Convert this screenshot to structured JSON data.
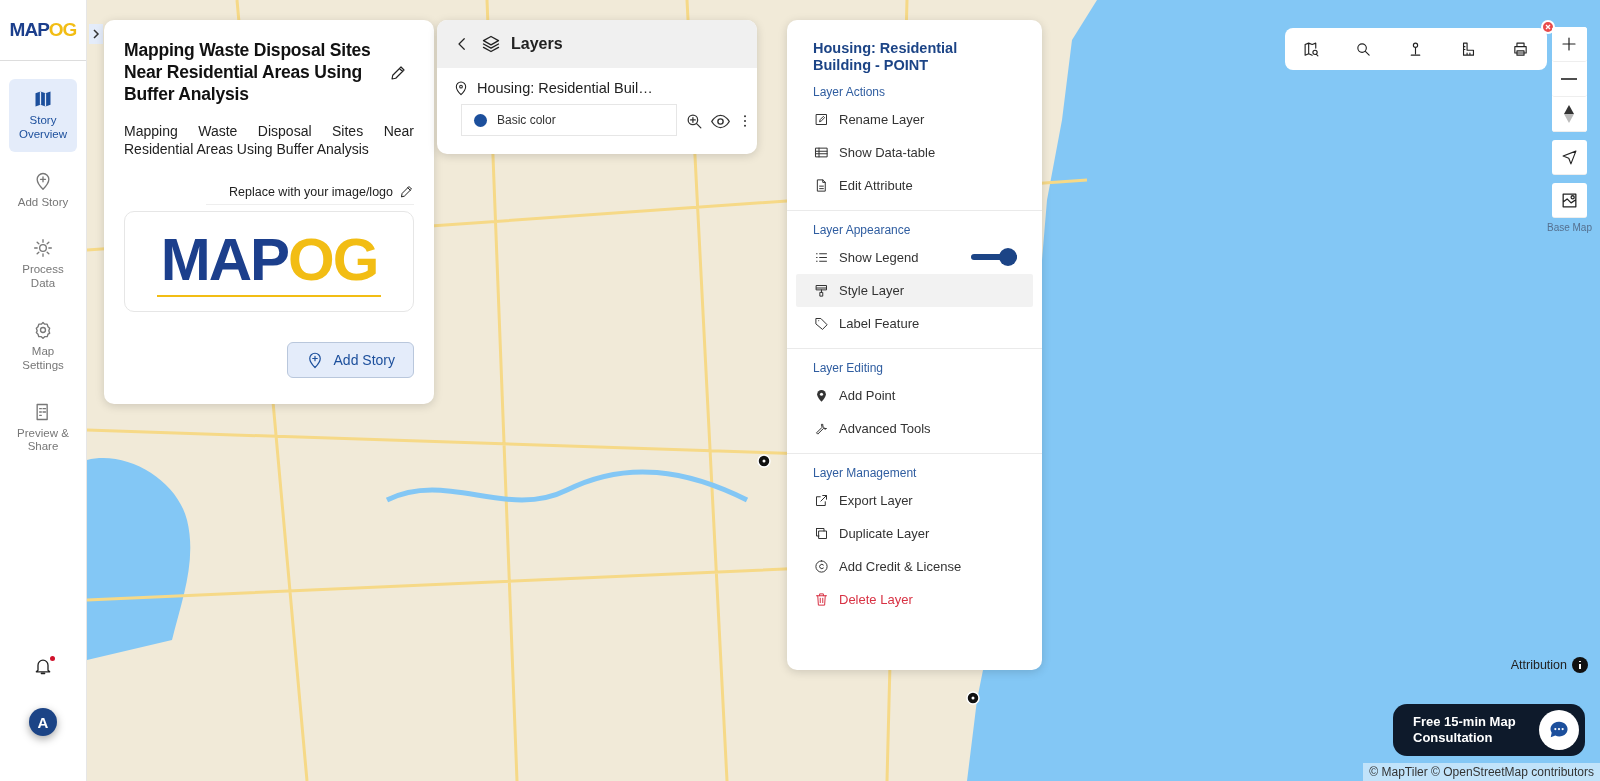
{
  "sidebar": {
    "logo": {
      "primary": "MAP",
      "accent": "OG"
    },
    "items": [
      {
        "label": "Story Overview",
        "selected": true
      },
      {
        "label": "Add Story",
        "selected": false
      },
      {
        "label": "Process Data",
        "selected": false
      },
      {
        "label": "Map Settings",
        "selected": false
      },
      {
        "label": "Preview & Share",
        "selected": false
      }
    ],
    "notifications": {
      "unread": true
    },
    "avatar": {
      "initial": "A"
    }
  },
  "story_card": {
    "title": "Mapping Waste Disposal Sites Near Residential Areas Using Buffer Analysis",
    "description": "Mapping Waste Disposal Sites Near Residential Areas Using Buffer Analysis",
    "image_hint": "Replace with your image/logo",
    "logo": {
      "primary": "MAP",
      "accent": "OG"
    },
    "button": "Add Story"
  },
  "layers_panel": {
    "title": "Layers",
    "layers": [
      {
        "name": "Housing: Residential Buil…",
        "legend": {
          "label": "Basic color",
          "color": "#1c4f9c"
        }
      }
    ]
  },
  "layer_menu": {
    "title": "Housing: Residential Building - POINT",
    "sections": [
      {
        "heading": "Layer Actions",
        "items": [
          {
            "label": "Rename Layer",
            "kind": "action",
            "selected": false
          },
          {
            "label": "Show Data-table",
            "kind": "action",
            "selected": false
          },
          {
            "label": "Edit Attribute",
            "kind": "action",
            "selected": false
          }
        ]
      },
      {
        "heading": "Layer Appearance",
        "items": [
          {
            "label": "Show Legend",
            "kind": "toggle",
            "on": true,
            "selected": false
          },
          {
            "label": "Style Layer",
            "kind": "action",
            "selected": true
          },
          {
            "label": "Label Feature",
            "kind": "action",
            "selected": false
          }
        ]
      },
      {
        "heading": "Layer Editing",
        "items": [
          {
            "label": "Add Point",
            "kind": "action",
            "selected": false
          },
          {
            "label": "Advanced Tools",
            "kind": "action",
            "selected": false
          }
        ]
      },
      {
        "heading": "Layer Management",
        "items": [
          {
            "label": "Export Layer",
            "kind": "action",
            "selected": false
          },
          {
            "label": "Duplicate Layer",
            "kind": "action",
            "selected": false
          },
          {
            "label": "Add Credit & License",
            "kind": "action",
            "selected": false
          },
          {
            "label": "Delete Layer",
            "kind": "danger",
            "selected": false
          }
        ]
      }
    ]
  },
  "map_controls": {
    "basemap_label": "Base Map",
    "attribution": "Attribution"
  },
  "consultation": {
    "label": "Free 15-min Map Consultation"
  },
  "footer": {
    "credits": "© MapTiler © OpenStreetMap contributors"
  }
}
